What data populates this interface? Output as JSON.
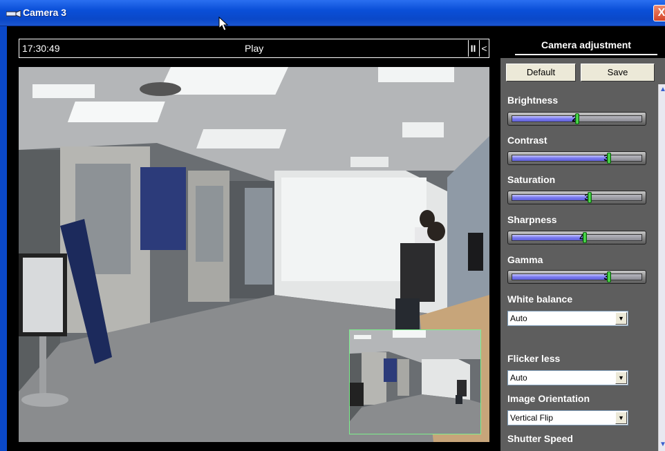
{
  "window": {
    "title": "Camera 3",
    "close_label": "X"
  },
  "video_header": {
    "time": "17:30:49",
    "status": "Play",
    "pause_label": "II",
    "collapse_label": "<"
  },
  "panel": {
    "tab_label": "Camera adjustment",
    "default_label": "Default",
    "save_label": "Save",
    "sliders": [
      {
        "label": "Brightness",
        "value": "2",
        "level": 0.5
      },
      {
        "label": "Contrast",
        "value": "3",
        "level": 0.75
      },
      {
        "label": "Saturation",
        "value": "3",
        "level": 0.6
      },
      {
        "label": "Sharpness",
        "value": "4",
        "level": 0.56
      },
      {
        "label": "Gamma",
        "value": "3",
        "level": 0.75
      }
    ],
    "white_balance": {
      "label": "White balance",
      "value": "Auto"
    },
    "flicker": {
      "label": "Flicker less",
      "value": "Auto"
    },
    "orientation": {
      "label": "Image Orientation",
      "value": "Vertical Flip"
    },
    "shutter": {
      "label": "Shutter Speed"
    }
  },
  "colors": {
    "titlebar": "#0a48c8",
    "panel_bg": "#5e5e5e",
    "slider_fill": "#7a7af0",
    "knob": "#40d040",
    "pip_border": "#7cf08c"
  }
}
